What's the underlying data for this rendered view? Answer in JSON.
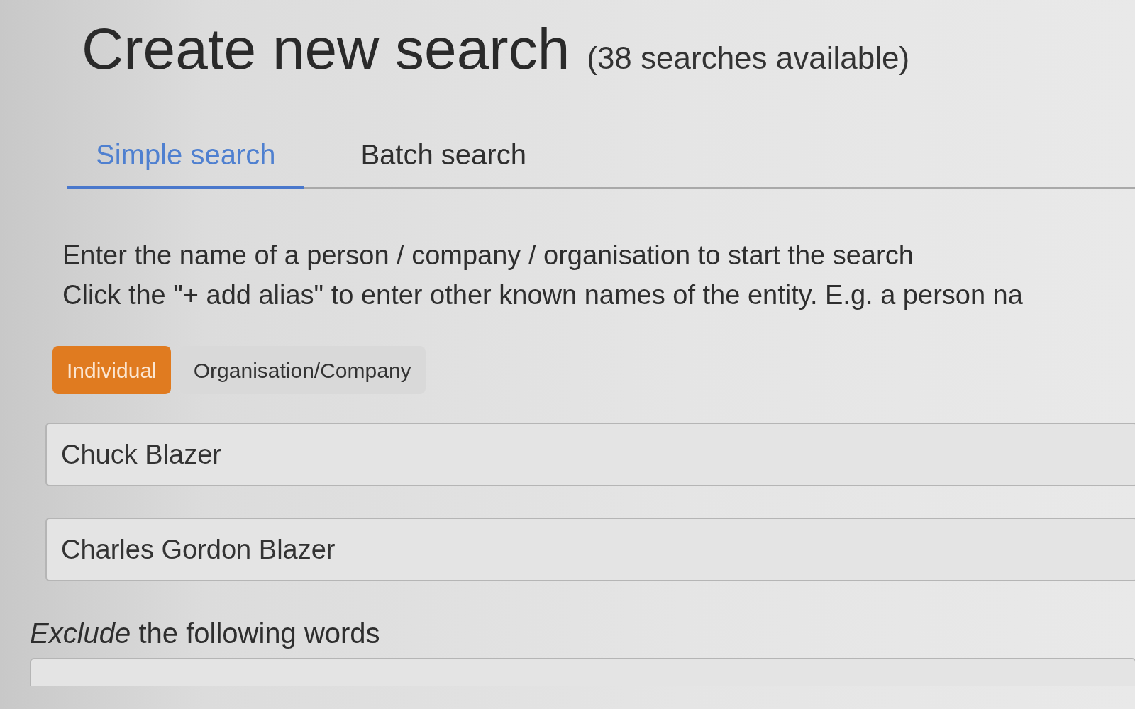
{
  "heading": {
    "title": "Create new search",
    "subtitle": "(38 searches available)"
  },
  "tabs": [
    {
      "label": "Simple search",
      "selected": true
    },
    {
      "label": "Batch search",
      "selected": false
    }
  ],
  "instructions": [
    "Enter the name of a person / company / organisation to start the search",
    "Click the \"+ add alias\" to enter other known names of the entity. E.g. a person na"
  ],
  "entity_types": [
    {
      "label": "Individual",
      "selected": true
    },
    {
      "label": "Organisation/Company",
      "selected": false
    }
  ],
  "names": [
    {
      "value": "Chuck Blazer"
    },
    {
      "value": "Charles Gordon Blazer"
    }
  ],
  "exclude": {
    "label": "*Exclude* the following words"
  }
}
